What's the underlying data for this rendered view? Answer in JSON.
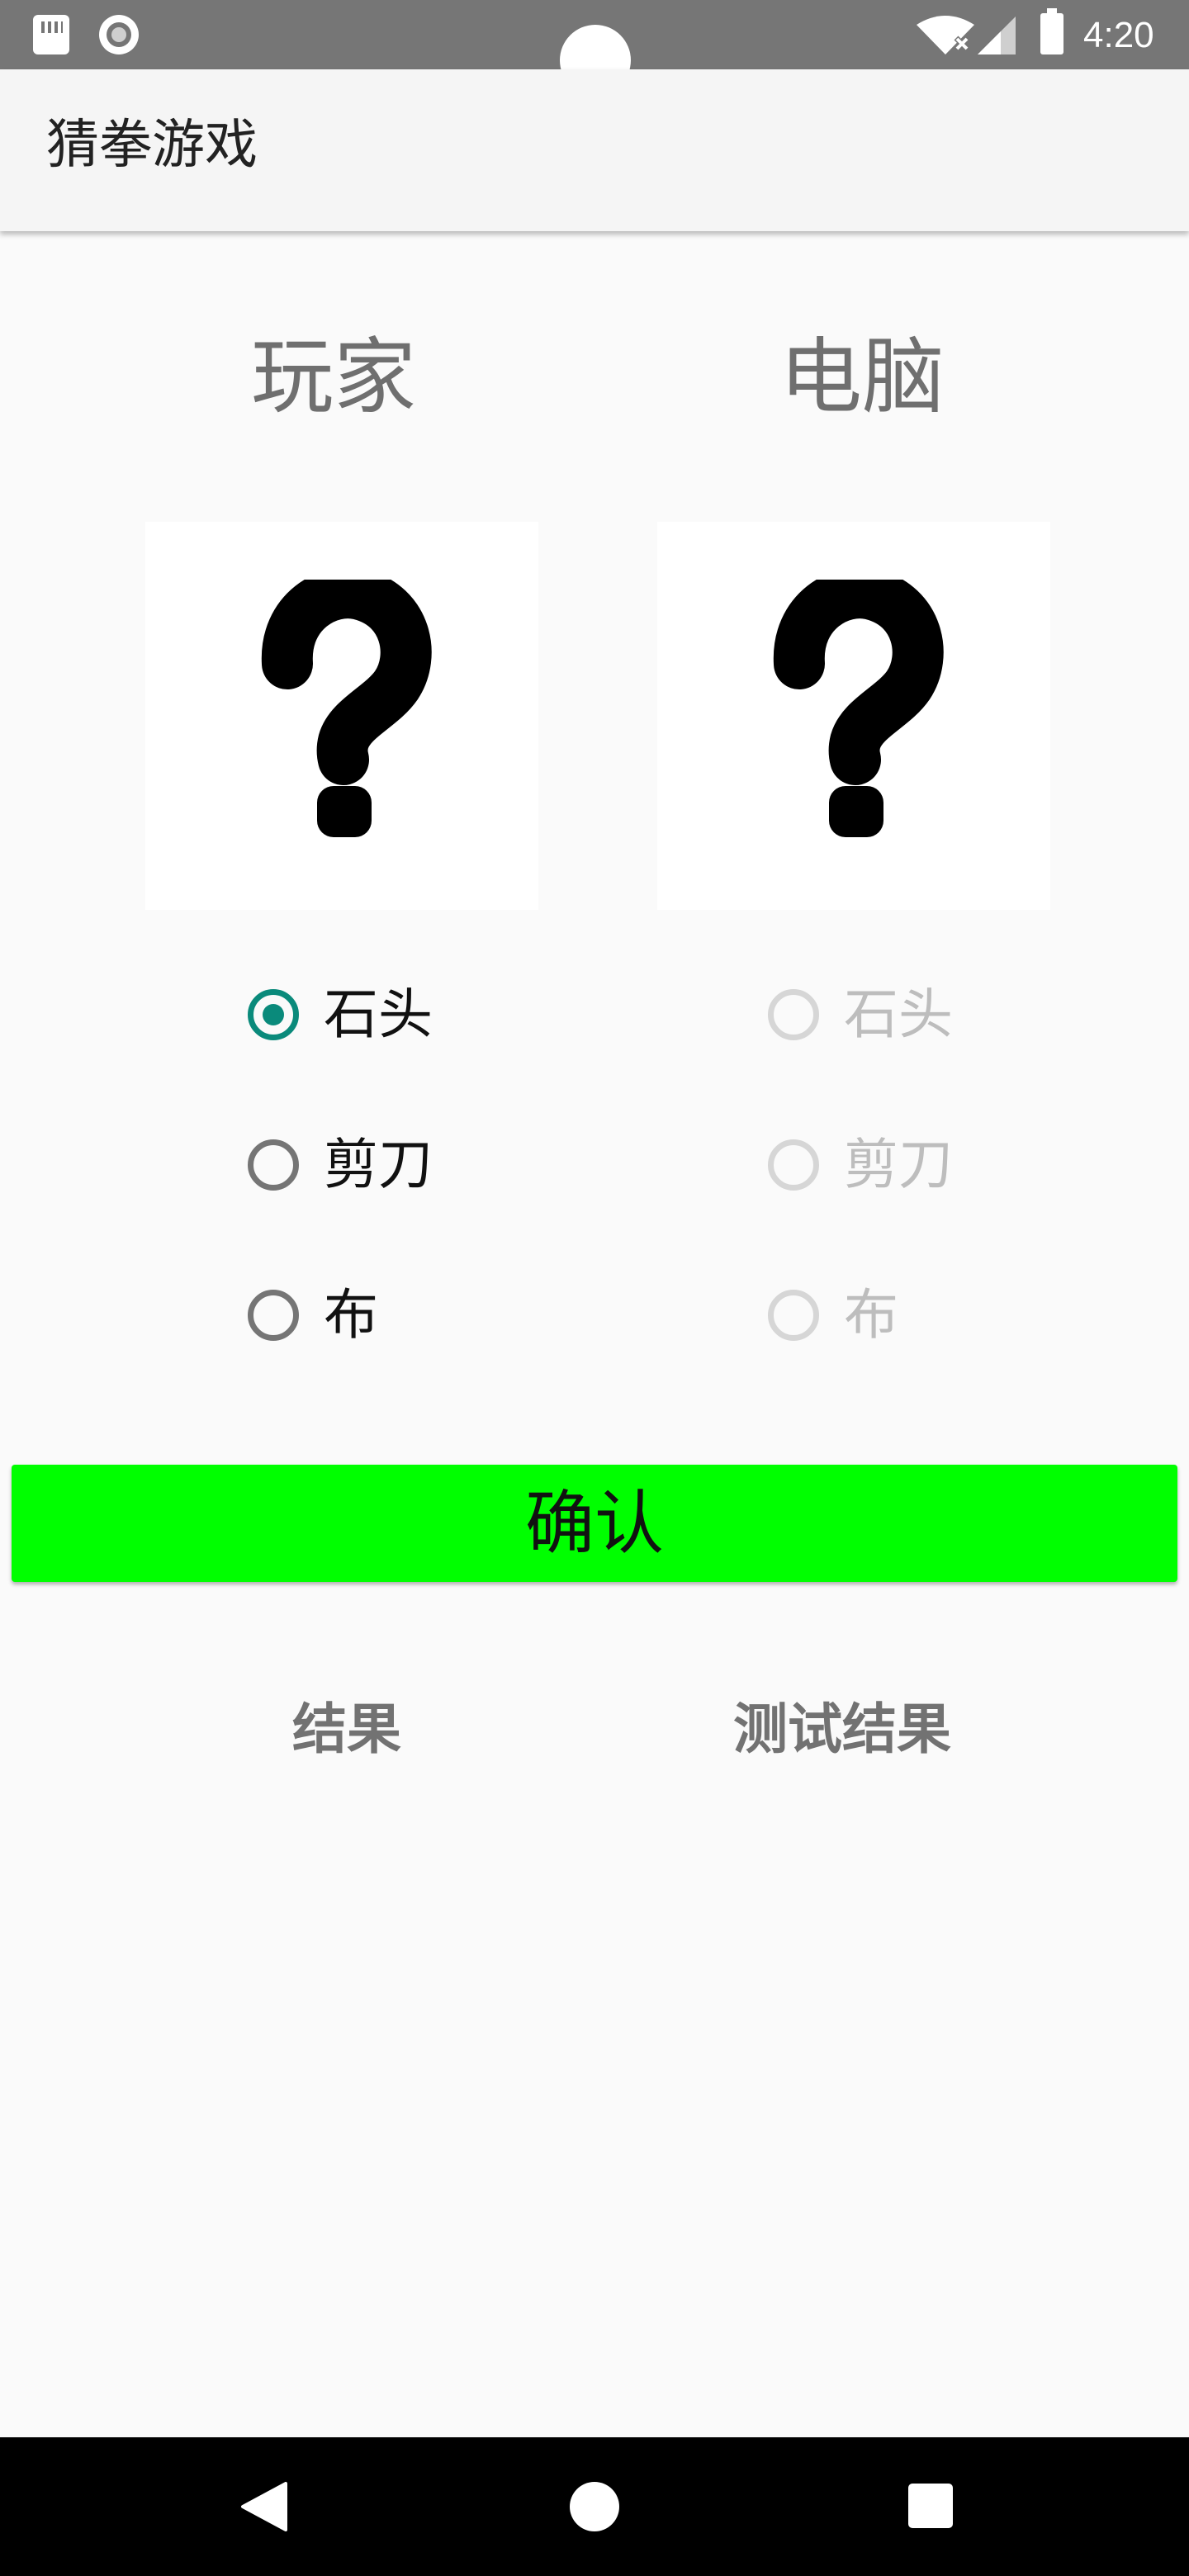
{
  "status_bar": {
    "time": "4:20",
    "icons": [
      "sd-card-icon",
      "record-icon",
      "wifi-icon",
      "signal-icon",
      "battery-icon"
    ]
  },
  "app_bar": {
    "title": "猜拳游戏"
  },
  "player": {
    "header": "玩家",
    "image_icon": "question-mark-icon",
    "options": [
      {
        "label": "石头",
        "checked": true
      },
      {
        "label": "剪刀",
        "checked": false
      },
      {
        "label": "布",
        "checked": false
      }
    ]
  },
  "computer": {
    "header": "电脑",
    "image_icon": "question-mark-icon",
    "options": [
      {
        "label": "石头",
        "checked": false,
        "enabled": false
      },
      {
        "label": "剪刀",
        "checked": false,
        "enabled": false
      },
      {
        "label": "布",
        "checked": false,
        "enabled": false
      }
    ]
  },
  "confirm_label": "确认",
  "results": {
    "result_label": "结果",
    "test_result_label": "测试结果"
  },
  "colors": {
    "status_bar": "#767676",
    "accent": "#0a8a7b",
    "confirm_button": "#00ff00",
    "navigation_bar": "#000000"
  },
  "navigation_bar": {
    "icons": [
      "back-icon",
      "home-icon",
      "recents-icon"
    ]
  }
}
